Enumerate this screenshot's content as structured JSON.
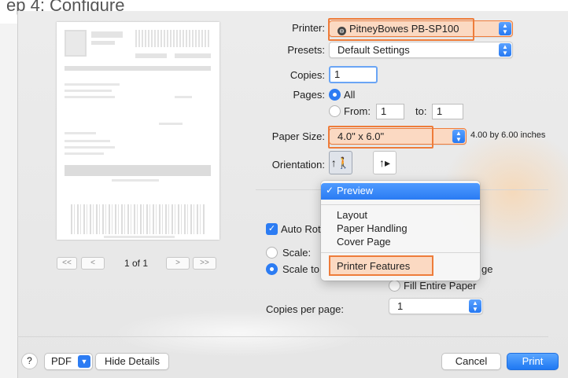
{
  "background": {
    "heading_fragment": "ep 4: Configure"
  },
  "printer": {
    "label": "Printer:",
    "value": "PitneyBowes PB-SP100"
  },
  "presets": {
    "label": "Presets:",
    "value": "Default Settings"
  },
  "copies": {
    "label": "Copies:",
    "value": "1"
  },
  "pages": {
    "label": "Pages:",
    "all_label": "All",
    "from_label": "From:",
    "from_value": "1",
    "to_label": "to:",
    "to_value": "1"
  },
  "paper_size": {
    "label": "Paper Size:",
    "value": "4.0\" x 6.0\"",
    "description": "4.00 by 6.00 inches"
  },
  "orientation": {
    "label": "Orientation:"
  },
  "section_menu": {
    "selected": "Preview",
    "items": [
      "Layout",
      "Paper Handling",
      "Cover Page"
    ],
    "highlighted": "Printer Features"
  },
  "options": {
    "auto_rotate": "Auto Rot",
    "scale": "Scale:",
    "scale_to": "Scale to",
    "scale_to_fit_suffix": "ge",
    "fill_entire": "Fill Entire Paper"
  },
  "copies_per_page": {
    "label": "Copies per page:",
    "value": "1"
  },
  "preview_nav": {
    "page_indicator": "1 of 1",
    "first": "<<",
    "prev": "<",
    "next": ">",
    "last": ">>"
  },
  "bottom": {
    "help": "?",
    "pdf": "PDF",
    "hide_details": "Hide Details",
    "cancel": "Cancel",
    "print": "Print"
  },
  "colors": {
    "accent": "#2c7cf3",
    "highlight_border": "#ee7c3a",
    "highlight_fill": "#fbd9c2"
  }
}
